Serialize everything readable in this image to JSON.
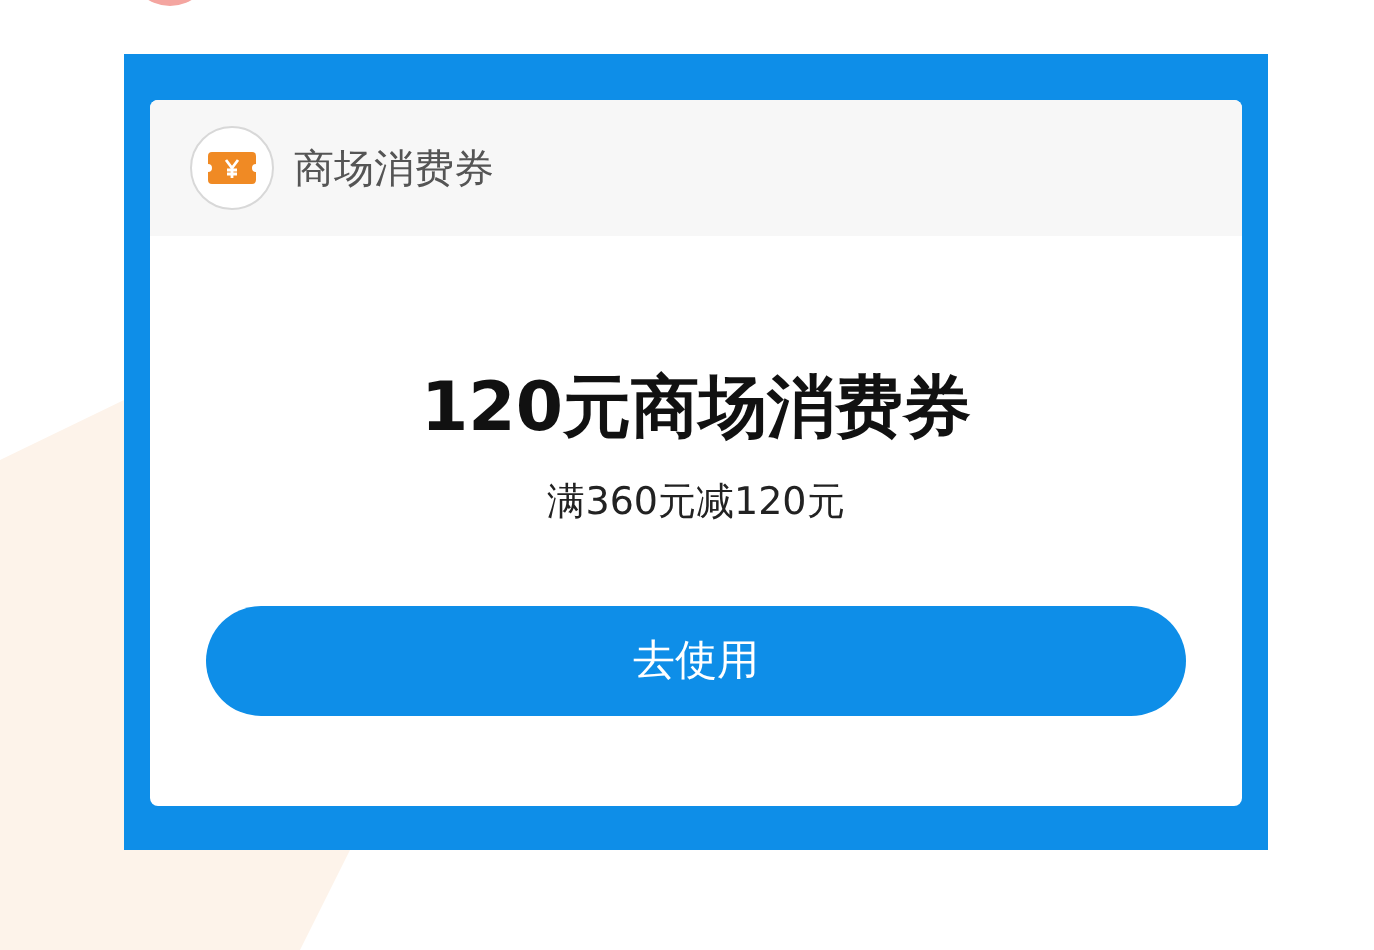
{
  "coupon": {
    "category": "商场消费券",
    "title": "120元商场消费券",
    "condition": "满360元减120元",
    "button": "去使用"
  }
}
